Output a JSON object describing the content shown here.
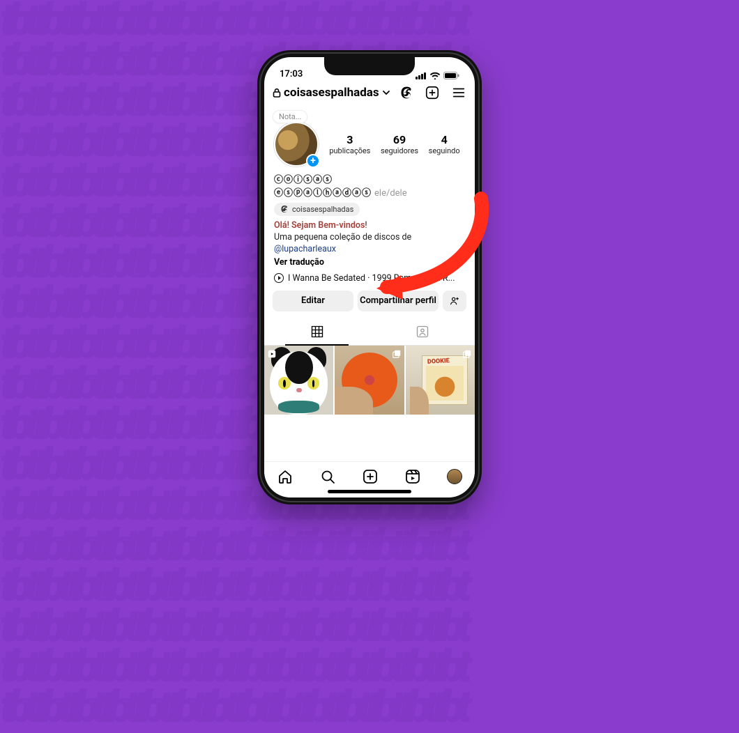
{
  "status": {
    "time": "17:03"
  },
  "header": {
    "username": "coisasespalhadas"
  },
  "note": {
    "label": "Nota..."
  },
  "stats": {
    "posts": {
      "count": "3",
      "label": "publicações"
    },
    "followers": {
      "count": "69",
      "label": "seguidores"
    },
    "following": {
      "count": "4",
      "label": "seguindo"
    }
  },
  "profile": {
    "display_name": "ⓒⓞⓘⓢⓐⓢ ⓔⓢⓟⓐⓛⓗⓐⓓⓐⓢ",
    "pronouns": "ele/dele",
    "threads_handle": "coisasespalhadas",
    "bio_greeting": "Olá! Sejam Bem-vindos",
    "bio_line2": "Uma pequena coleção de discos de",
    "bio_mention": "@lupacharleaux",
    "see_translation": "Ver tradução",
    "music": "I Wanna Be Sedated · 1999 Remastered R..."
  },
  "buttons": {
    "edit": "Editar",
    "share": "Compartilhar perfil"
  },
  "album_tile": {
    "title": "DOOKIE"
  }
}
